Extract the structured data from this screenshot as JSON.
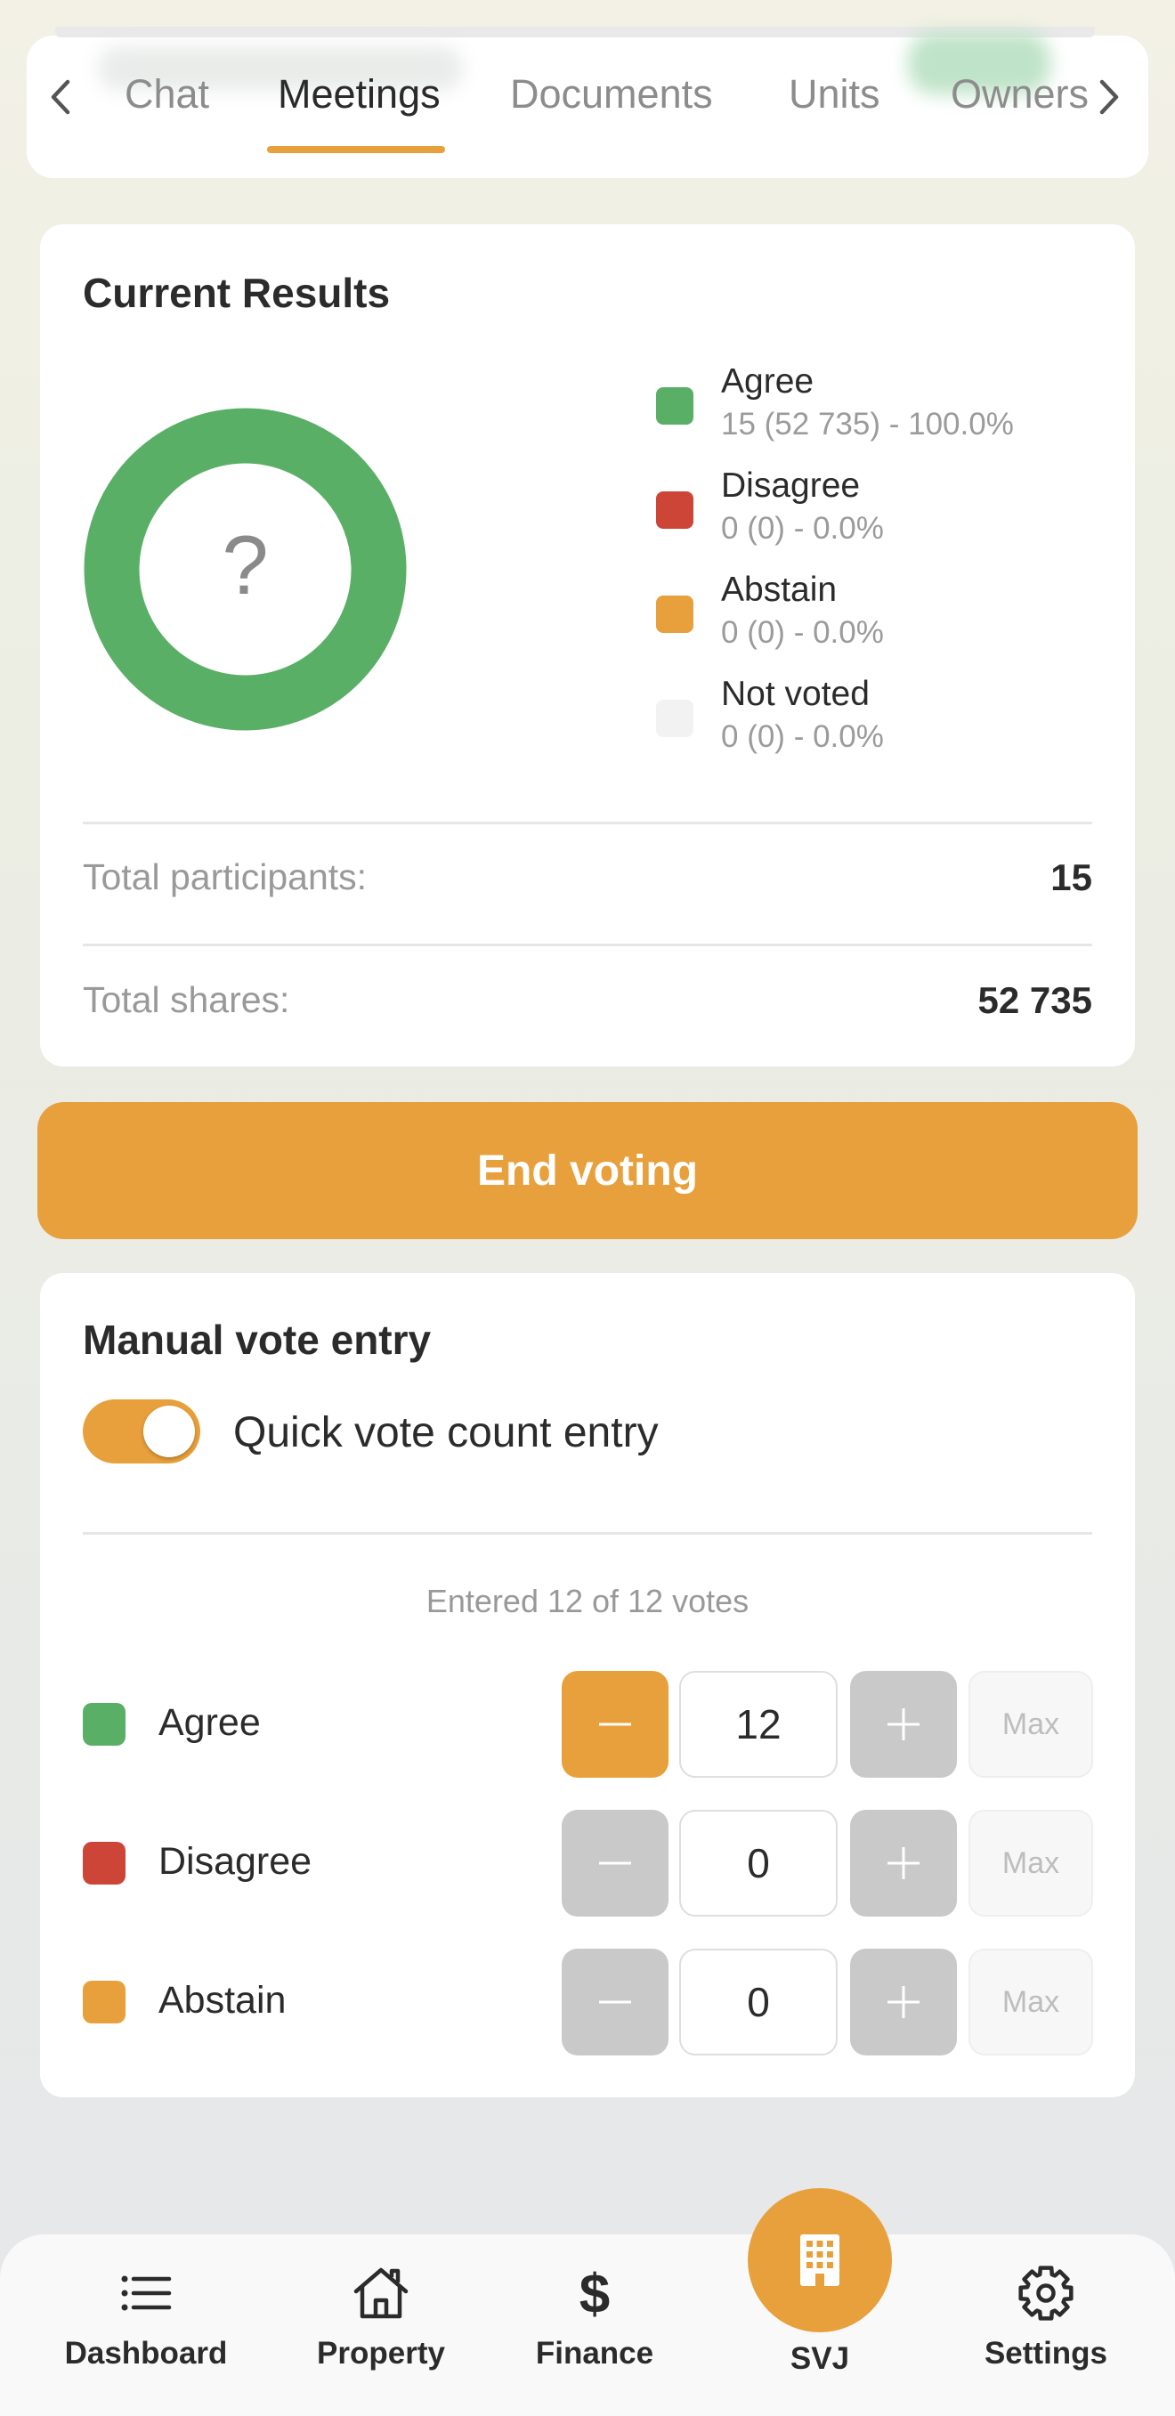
{
  "tabs": {
    "items": [
      {
        "label": "s"
      },
      {
        "label": "Chat"
      },
      {
        "label": "Meetings"
      },
      {
        "label": "Documents"
      },
      {
        "label": "Units"
      },
      {
        "label": "Owners"
      }
    ],
    "active_index": 2
  },
  "results": {
    "title": "Current Results",
    "donut_center": "?",
    "legend": [
      {
        "label": "Agree",
        "detail": "15 (52 735) - 100.0%",
        "color": "#5aaf66",
        "percent": 100.0
      },
      {
        "label": "Disagree",
        "detail": "0 (0) - 0.0%",
        "color": "#cc4536",
        "percent": 0.0
      },
      {
        "label": "Abstain",
        "detail": "0 (0) - 0.0%",
        "color": "#e8a03c",
        "percent": 0.0
      },
      {
        "label": "Not voted",
        "detail": "0 (0) - 0.0%",
        "color": "#f2f2f2",
        "percent": 0.0
      }
    ],
    "total_participants_label": "Total participants:",
    "total_participants_value": "15",
    "total_shares_label": "Total shares:",
    "total_shares_value": "52 735"
  },
  "end_voting_label": "End voting",
  "manual": {
    "title": "Manual vote entry",
    "toggle_label": "Quick vote count entry",
    "toggle_on": true,
    "entered_text": "Entered 12 of 12 votes",
    "max_label": "Max",
    "rows": [
      {
        "label": "Agree",
        "count": "12",
        "color": "#5aaf66",
        "minus_active": true
      },
      {
        "label": "Disagree",
        "count": "0",
        "color": "#cc4536",
        "minus_active": false
      },
      {
        "label": "Abstain",
        "count": "0",
        "color": "#e8a03c",
        "minus_active": false
      }
    ]
  },
  "nav": {
    "dashboard": "Dashboard",
    "property": "Property",
    "finance": "Finance",
    "svj": "SVJ",
    "settings": "Settings"
  },
  "colors": {
    "accent": "#e8a03c",
    "agree": "#5aaf66",
    "disagree": "#cc4536",
    "disabled_button": "#c9c9c9"
  }
}
